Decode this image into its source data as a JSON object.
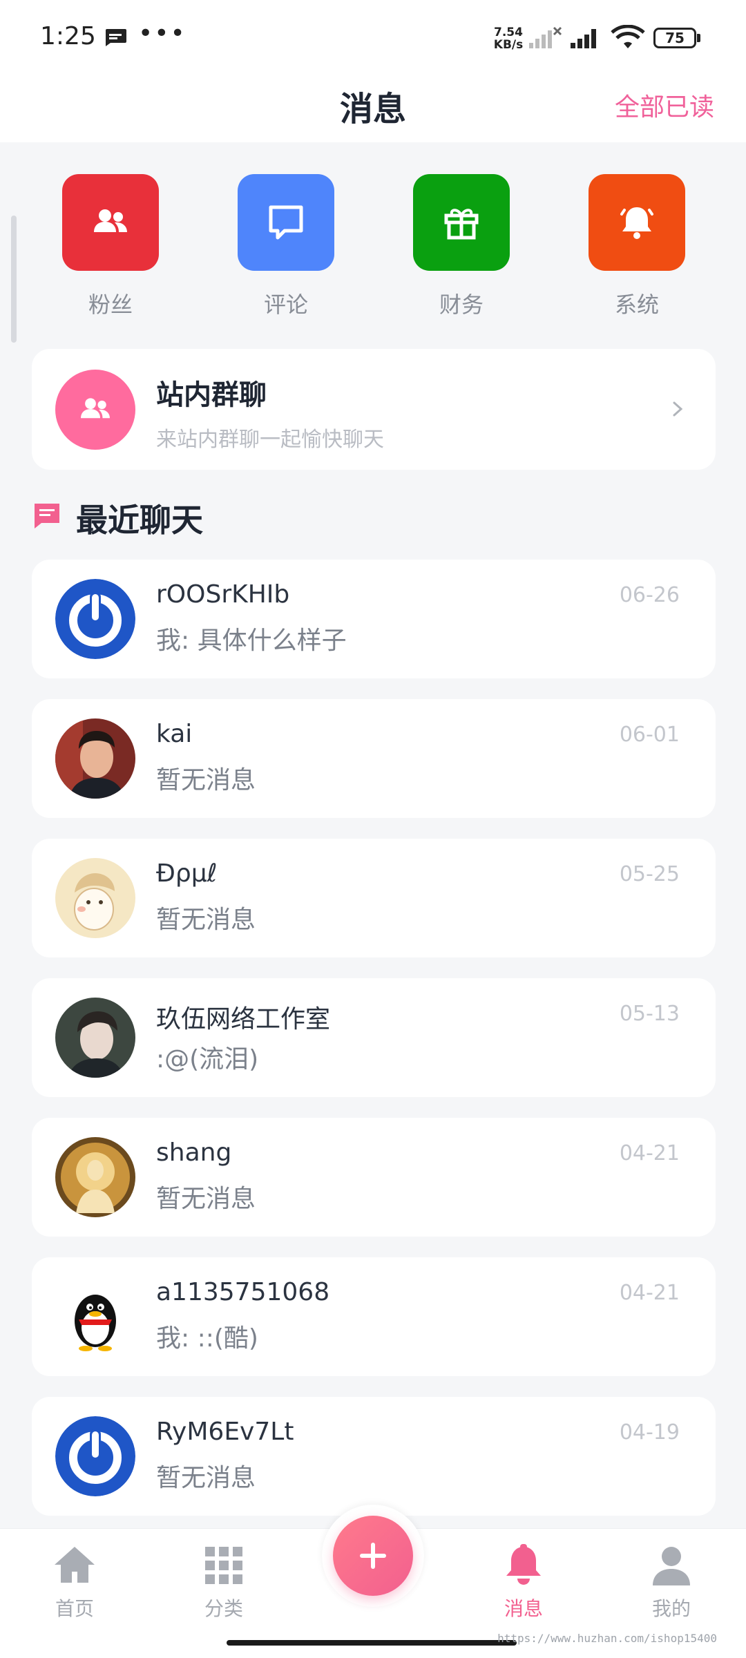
{
  "status_bar": {
    "time": "1:25",
    "dots": "•••",
    "speed_value": "7.54",
    "speed_unit": "KB/s",
    "battery": "75"
  },
  "header": {
    "title": "消息",
    "mark_all_read": "全部已读"
  },
  "quick_actions": [
    {
      "label": "粉丝",
      "icon": "users-icon",
      "color": "#e8303a"
    },
    {
      "label": "评论",
      "icon": "comment-icon",
      "color": "#4f85fb"
    },
    {
      "label": "财务",
      "icon": "gift-icon",
      "color": "#0aa010"
    },
    {
      "label": "系统",
      "icon": "bell-icon",
      "color": "#f04d12"
    }
  ],
  "group_chat": {
    "title": "站内群聊",
    "subtitle": "来站内群聊一起愉快聊天"
  },
  "recent": {
    "title": "最近聊天"
  },
  "chats": [
    {
      "name": "rOOSrKHIb",
      "preview": "我: 具体什么样子",
      "date": "06-26",
      "avatar": "power-logo-avatar"
    },
    {
      "name": "kai",
      "preview": "暂无消息",
      "date": "06-01",
      "avatar": "photo-avatar"
    },
    {
      "name": "Ɖρμℓ",
      "preview": "暂无消息",
      "date": "05-25",
      "avatar": "cartoon-avatar"
    },
    {
      "name": "玖伍网络工作室",
      "preview": ":@(流泪)",
      "date": "05-13",
      "avatar": "photo-avatar"
    },
    {
      "name": "shang",
      "preview": "暂无消息",
      "date": "04-21",
      "avatar": "buddha-avatar"
    },
    {
      "name": "a1135751068",
      "preview": "我: ::(酷)",
      "date": "04-21",
      "avatar": "penguin-avatar"
    },
    {
      "name": "RyM6Ev7Lt",
      "preview": "暂无消息",
      "date": "04-19",
      "avatar": "power-logo-avatar"
    }
  ],
  "bottom_nav": {
    "home": "首页",
    "category": "分类",
    "messages": "消息",
    "mine": "我的"
  },
  "colors": {
    "accent": "#f2608f",
    "background": "#f5f6f8"
  },
  "watermark": "https://www.huzhan.com/ishop15400"
}
